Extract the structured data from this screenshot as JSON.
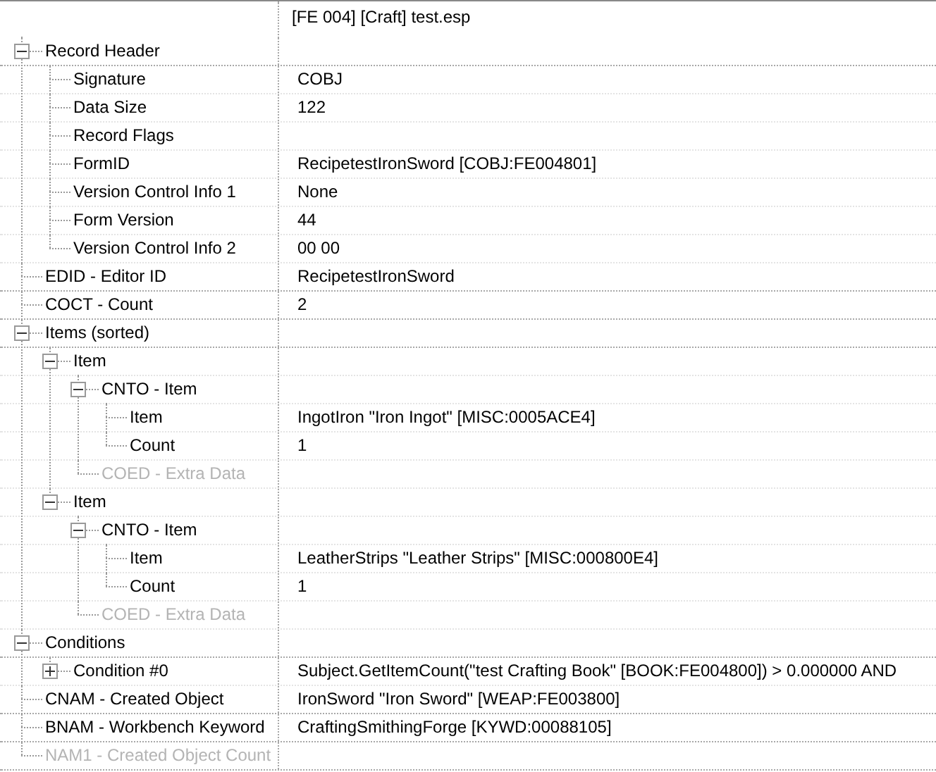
{
  "header": {
    "value": "[FE 004] [Craft] test.esp"
  },
  "nodes": [
    {
      "label": "Record Header",
      "expanded": true,
      "disabled": false,
      "children": [
        {
          "label": "Signature",
          "value": "COBJ",
          "disabled": false
        },
        {
          "label": "Data Size",
          "value": "122",
          "disabled": false
        },
        {
          "label": "Record Flags",
          "disabled": false
        },
        {
          "label": "FormID",
          "value": "RecipetestIronSword [COBJ:FE004801]",
          "disabled": false
        },
        {
          "label": "Version Control Info 1",
          "value": "None",
          "disabled": false
        },
        {
          "label": "Form Version",
          "value": "44",
          "disabled": false
        },
        {
          "label": "Version Control Info 2",
          "value": "00 00",
          "disabled": false
        }
      ]
    },
    {
      "label": "EDID - Editor ID",
      "value": "RecipetestIronSword",
      "disabled": false
    },
    {
      "label": "COCT - Count",
      "value": "2",
      "disabled": false
    },
    {
      "label": "Items (sorted)",
      "expanded": true,
      "disabled": false,
      "children": [
        {
          "label": "Item",
          "expanded": true,
          "disabled": false,
          "children": [
            {
              "label": "CNTO - Item",
              "expanded": true,
              "disabled": false,
              "children": [
                {
                  "label": "Item",
                  "value": "IngotIron \"Iron Ingot\" [MISC:0005ACE4]",
                  "disabled": false
                },
                {
                  "label": "Count",
                  "value": "1",
                  "disabled": false
                }
              ]
            },
            {
              "label": "COED - Extra Data",
              "disabled": true
            }
          ]
        },
        {
          "label": "Item",
          "expanded": true,
          "disabled": false,
          "children": [
            {
              "label": "CNTO - Item",
              "expanded": true,
              "disabled": false,
              "children": [
                {
                  "label": "Item",
                  "value": "LeatherStrips \"Leather Strips\" [MISC:000800E4]",
                  "disabled": false
                },
                {
                  "label": "Count",
                  "value": "1",
                  "disabled": false
                }
              ]
            },
            {
              "label": "COED - Extra Data",
              "disabled": true
            }
          ]
        }
      ]
    },
    {
      "label": "Conditions",
      "expanded": true,
      "disabled": false,
      "children": [
        {
          "label": "Condition #0",
          "expanded": false,
          "value": "Subject.GetItemCount(\"test Crafting Book\" [BOOK:FE004800]) > 0.000000 AND",
          "disabled": false
        }
      ]
    },
    {
      "label": "CNAM - Created Object",
      "value": "IronSword \"Iron Sword\" [WEAP:FE003800]",
      "disabled": false
    },
    {
      "label": "BNAM - Workbench Keyword",
      "value": "CraftingSmithingForge [KYWD:00088105]",
      "disabled": false
    },
    {
      "label": "NAM1 - Created Object Count",
      "disabled": true
    }
  ]
}
